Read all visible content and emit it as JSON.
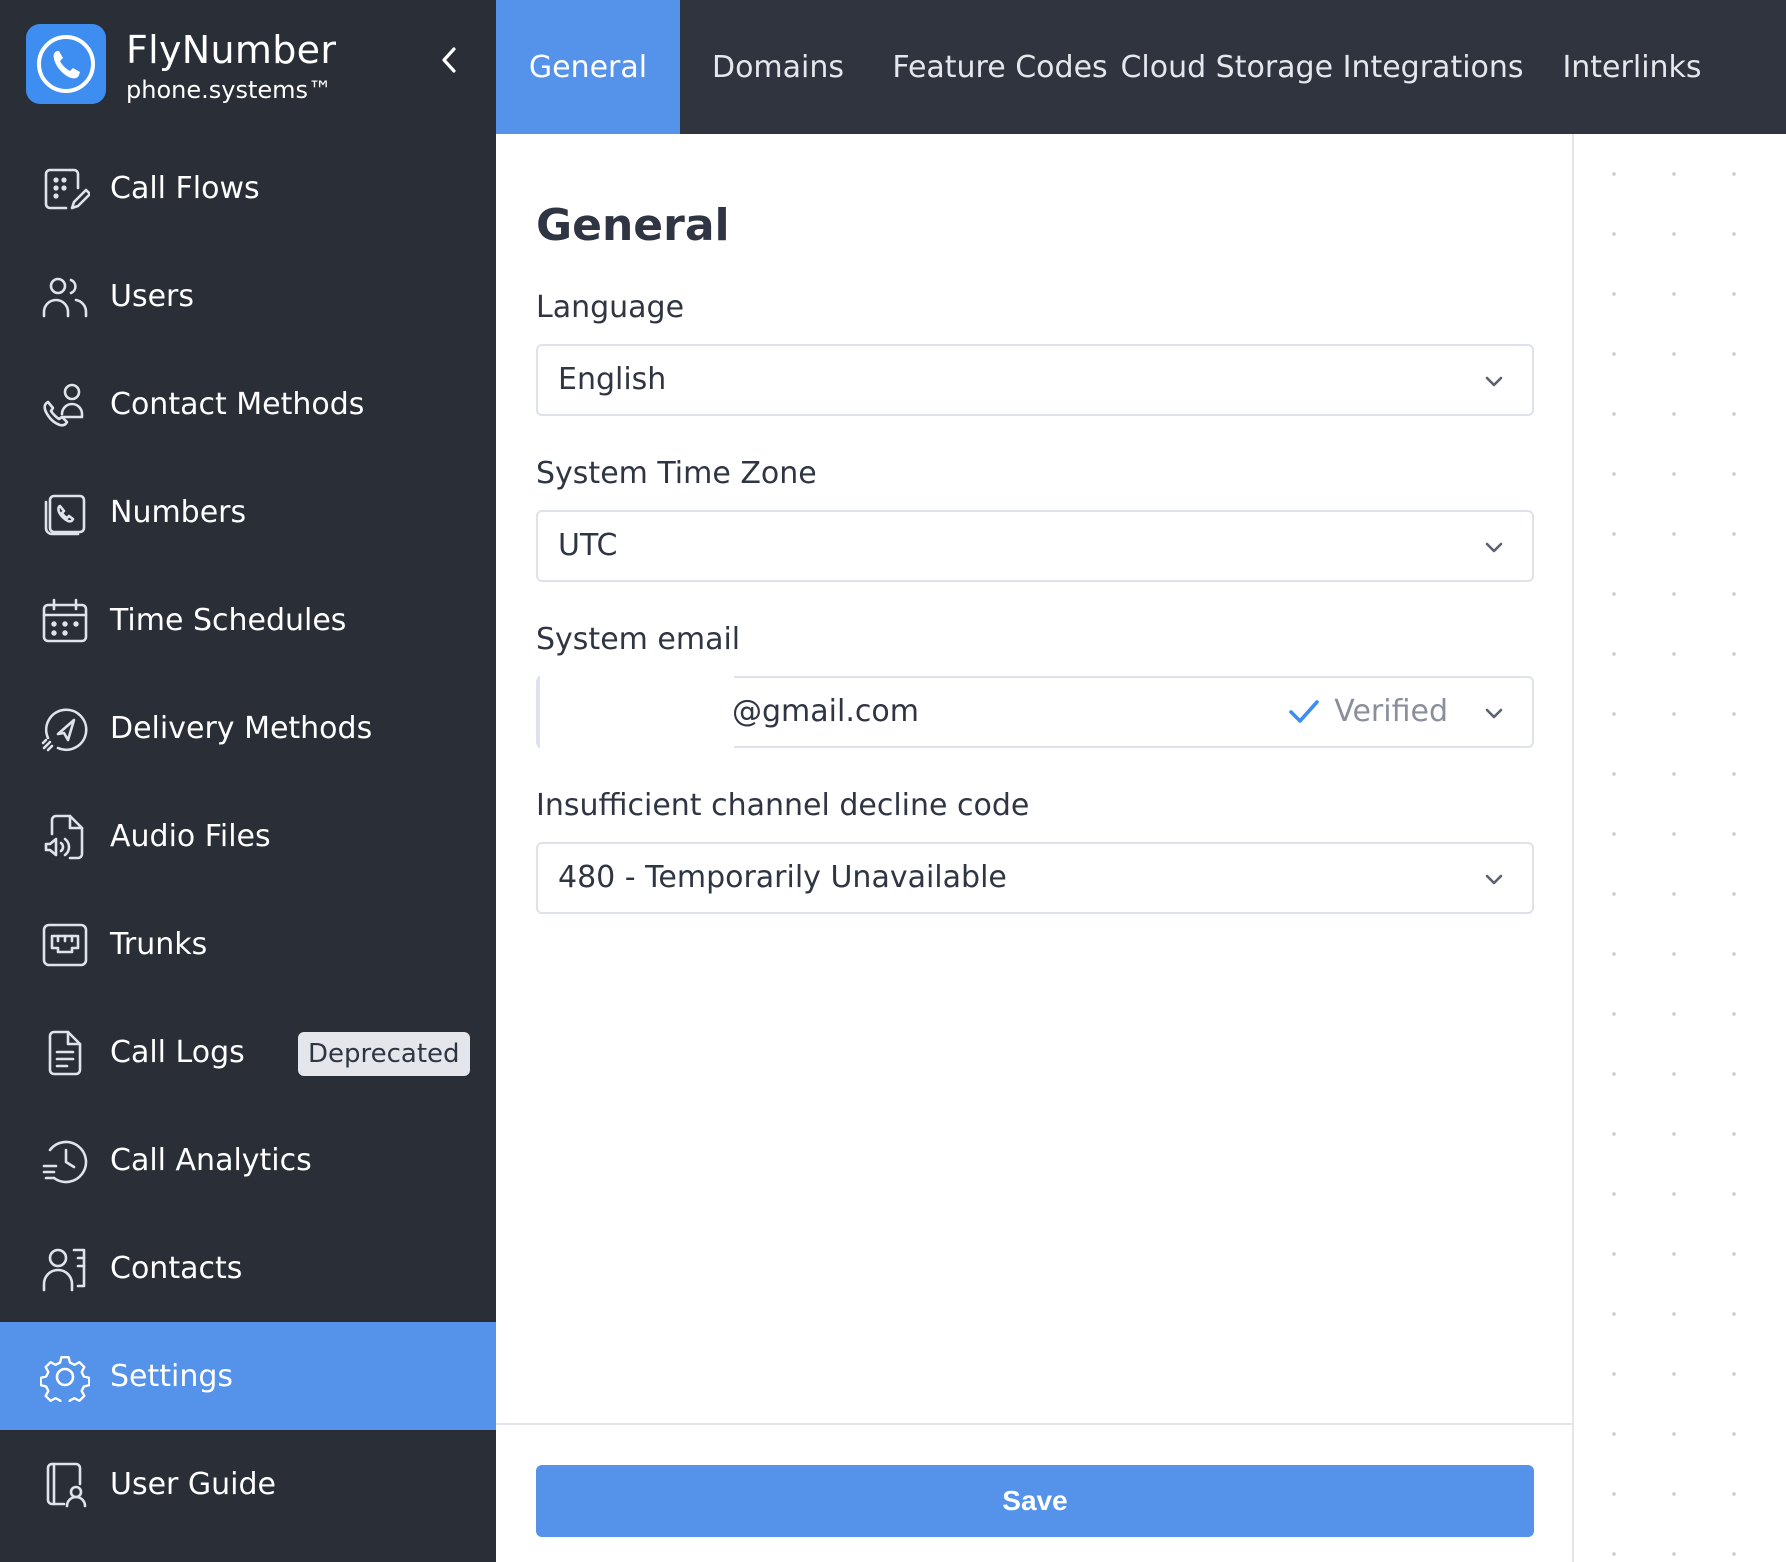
{
  "brand": {
    "name": "FlyNumber",
    "subtitle": "phone.systems™",
    "logo_icon": "phone-icon",
    "accent": "#3e8ef2"
  },
  "sidebar": {
    "items": [
      {
        "label": "Call Flows",
        "icon": "call-flows-icon"
      },
      {
        "label": "Users",
        "icon": "users-icon"
      },
      {
        "label": "Contact Methods",
        "icon": "contact-methods-icon"
      },
      {
        "label": "Numbers",
        "icon": "numbers-icon"
      },
      {
        "label": "Time Schedules",
        "icon": "calendar-icon"
      },
      {
        "label": "Delivery Methods",
        "icon": "delivery-icon"
      },
      {
        "label": "Audio Files",
        "icon": "audio-file-icon"
      },
      {
        "label": "Trunks",
        "icon": "trunks-icon"
      },
      {
        "label": "Call Logs",
        "icon": "call-logs-icon",
        "badge": "Deprecated"
      },
      {
        "label": "Call Analytics",
        "icon": "analytics-icon"
      },
      {
        "label": "Contacts",
        "icon": "contacts-icon"
      },
      {
        "label": "Settings",
        "icon": "gear-icon",
        "active": true
      },
      {
        "label": "User Guide",
        "icon": "user-guide-icon"
      }
    ],
    "background": "#2a2e37",
    "active_color": "#5592ea"
  },
  "tabs": [
    {
      "label": "General",
      "active": true
    },
    {
      "label": "Domains"
    },
    {
      "label": "Feature Codes"
    },
    {
      "label": "Cloud Storage Integrations"
    },
    {
      "label": "Interlinks"
    }
  ],
  "main": {
    "title": "General",
    "fields": {
      "language": {
        "label": "Language",
        "value": "English"
      },
      "timezone": {
        "label": "System Time Zone",
        "value": "UTC"
      },
      "email": {
        "label": "System email",
        "value": "@gmail.com",
        "status": "Verified"
      },
      "decline": {
        "label": "Insufficient channel decline code",
        "value": "480 - Temporarily Unavailable"
      }
    },
    "save_label": "Save"
  }
}
